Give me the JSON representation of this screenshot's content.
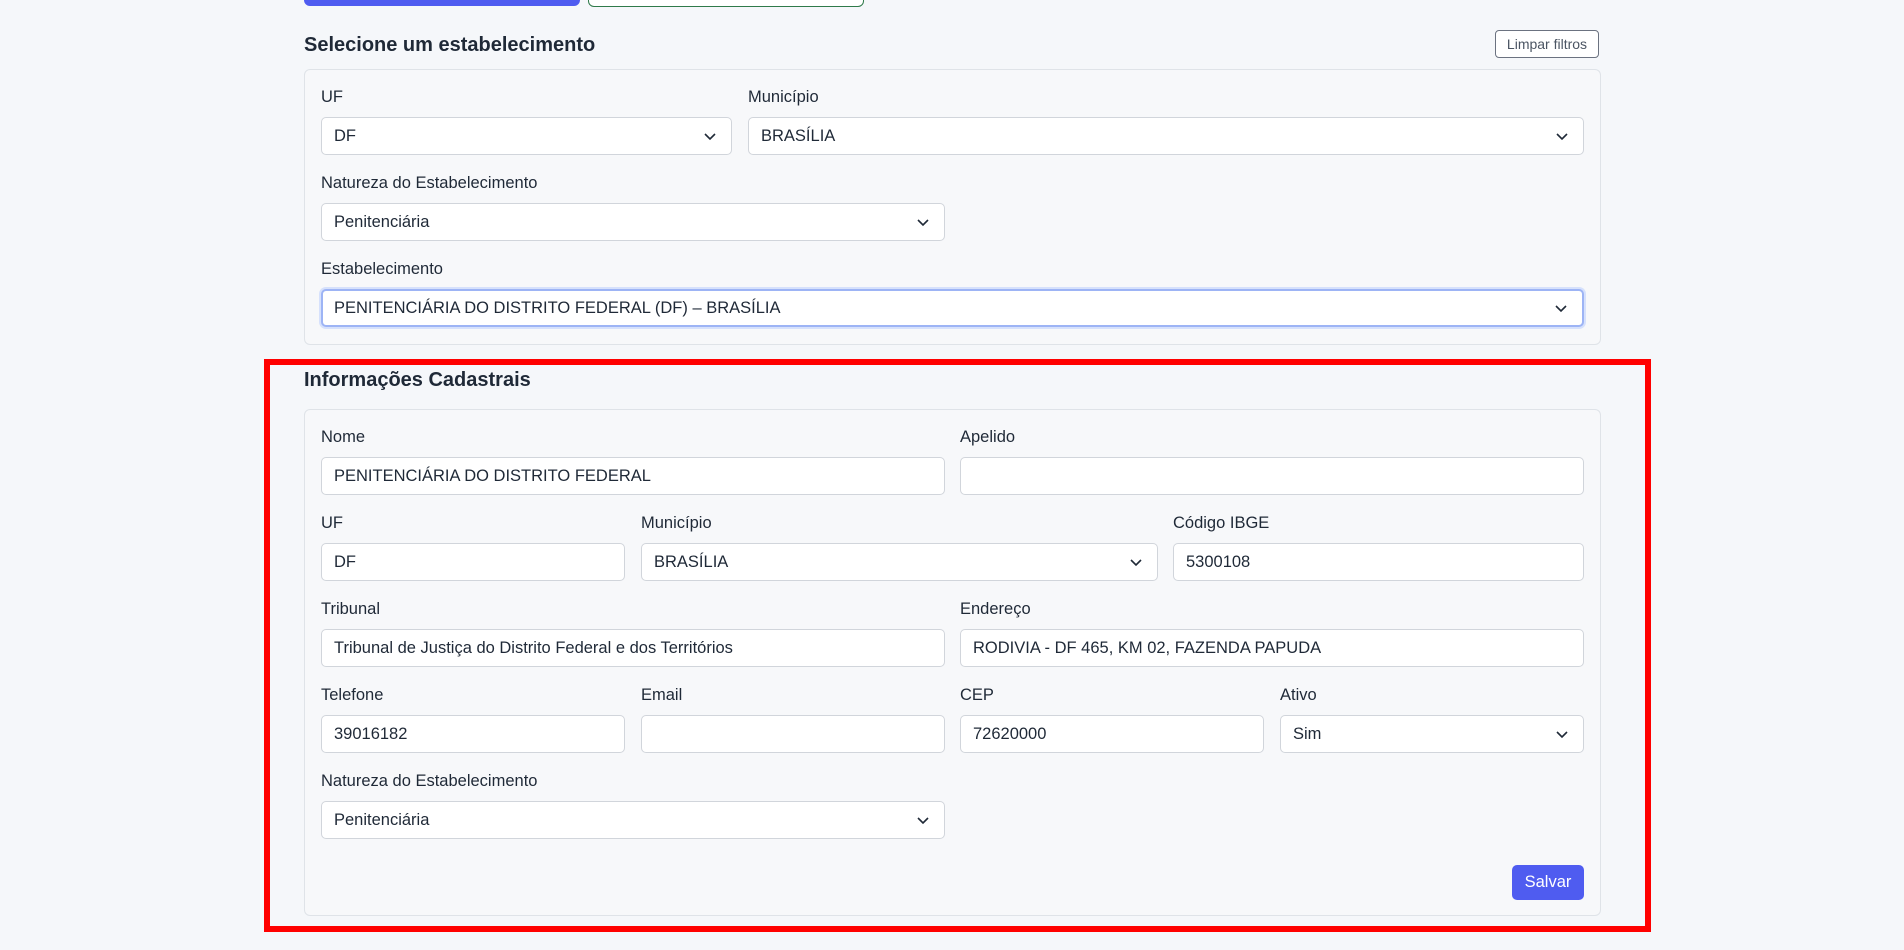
{
  "select_section": {
    "title": "Selecione um estabelecimento",
    "clear_label": "Limpar filtros",
    "uf_label": "UF",
    "uf_value": "DF",
    "municipio_label": "Município",
    "municipio_value": "BRASÍLIA",
    "natureza_label": "Natureza do Estabelecimento",
    "natureza_value": "Penitenciária",
    "estabelecimento_label": "Estabelecimento",
    "estabelecimento_value": "PENITENCIÁRIA DO DISTRITO FEDERAL (DF) – BRASÍLIA"
  },
  "info_section": {
    "title": "Informações Cadastrais",
    "nome_label": "Nome",
    "nome_value": "PENITENCIÁRIA DO DISTRITO FEDERAL",
    "apelido_label": "Apelido",
    "apelido_value": "",
    "uf_label": "UF",
    "uf_value": "DF",
    "municipio_label": "Município",
    "municipio_value": "BRASÍLIA",
    "ibge_label": "Código IBGE",
    "ibge_value": "5300108",
    "tribunal_label": "Tribunal",
    "tribunal_value": "Tribunal de Justiça do Distrito Federal e dos Territórios",
    "endereco_label": "Endereço",
    "endereco_value": "RODIVIA - DF 465, KM 02, FAZENDA PAPUDA",
    "telefone_label": "Telefone",
    "telefone_value": "39016182",
    "email_label": "Email",
    "email_value": "",
    "cep_label": "CEP",
    "cep_value": "72620000",
    "ativo_label": "Ativo",
    "ativo_value": "Sim",
    "natureza_label": "Natureza do Estabelecimento",
    "natureza_value": "Penitenciária",
    "save_label": "Salvar"
  },
  "colors": {
    "primary": "#4f5cf0",
    "highlight": "#ff0000"
  }
}
